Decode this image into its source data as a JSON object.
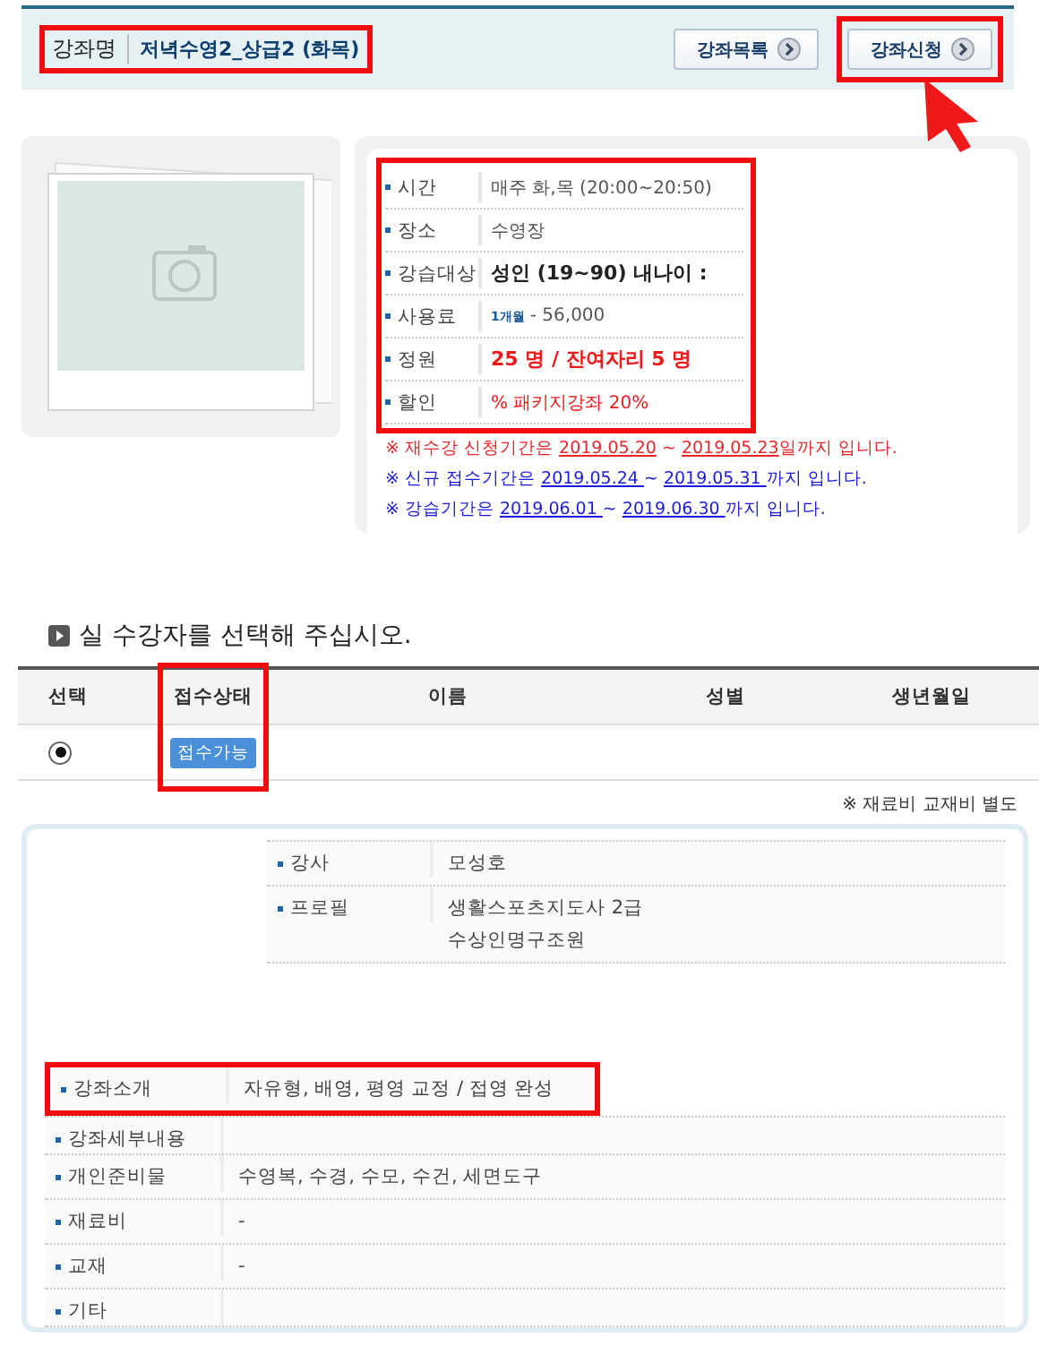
{
  "header": {
    "label": "강좌명",
    "title": "저녁수영2_상급2 (화목)",
    "highlighted": true,
    "buttons": [
      {
        "label": "강좌목록",
        "highlighted": false,
        "pointer": false
      },
      {
        "label": "강좌신청",
        "highlighted": true,
        "pointer": true
      }
    ]
  },
  "info": {
    "highlighted": true,
    "rows": [
      {
        "label": "시간",
        "value": "매주 화,목 (20:00~20:50)",
        "kind": "plain"
      },
      {
        "label": "장소",
        "value": "수영장",
        "kind": "plain"
      },
      {
        "label": "강습대상",
        "value": "성인 (19~90) 내나이 :",
        "kind": "bold"
      },
      {
        "label": "사용료",
        "badge": "1개월",
        "value": "- 56,000",
        "kind": "fee"
      },
      {
        "label": "정원",
        "value": "25 명 / 잔여자리 5 명",
        "kind": "alert"
      },
      {
        "label": "할인",
        "value": "% 패키지강좌 20%",
        "kind": "discount"
      }
    ]
  },
  "notices": [
    {
      "color": "#e8262b",
      "prefix": "※ 재수강 신청기간은 ",
      "from": "2019.05.20",
      "sep": " ~ ",
      "to": "2019.05.23",
      "suffix": "일까지 입니다."
    },
    {
      "color": "#1a1adf",
      "prefix": "※ 신규 접수기간은 ",
      "from": "2019.05.24 ",
      "sep": "~ ",
      "to": "2019.05.31 ",
      "suffix": "까지 입니다."
    },
    {
      "color": "#1a1adf",
      "prefix": "※ 강습기간은 ",
      "from": "2019.06.01 ",
      "sep": "~ ",
      "to": "2019.06.30 ",
      "suffix": "까지 입니다."
    }
  ],
  "section_heading": "실 수강자를 선택해 주십시오.",
  "table": {
    "columns": [
      {
        "label": "선택",
        "highlighted": false
      },
      {
        "label": "접수상태",
        "highlighted": true
      },
      {
        "label": "이름",
        "highlighted": false
      },
      {
        "label": "성별",
        "highlighted": false
      },
      {
        "label": "생년월일",
        "highlighted": false
      }
    ],
    "rows": [
      {
        "selected": true,
        "status": "접수가능"
      }
    ]
  },
  "fee_note": "※ 재료비 교재비 별도",
  "instructor": [
    {
      "label": "강사",
      "lines": [
        "모성호"
      ]
    },
    {
      "label": "프로필",
      "lines": [
        "생활스포츠지도사 2급",
        "수상인명구조원"
      ]
    }
  ],
  "details": [
    {
      "label": "강좌소개",
      "value": "자유형, 배영, 평영 교정 / 접영 완성",
      "highlighted": true
    },
    {
      "label": "강좌세부내용",
      "highlighted": false
    },
    {
      "label": "개인준비물",
      "value": "수영복, 수경, 수모, 수건, 세면도구",
      "highlighted": false
    },
    {
      "label": "재료비",
      "value": "-",
      "highlighted": false
    },
    {
      "label": "교재",
      "value": "-",
      "highlighted": false
    },
    {
      "label": "기타",
      "highlighted": false
    }
  ]
}
